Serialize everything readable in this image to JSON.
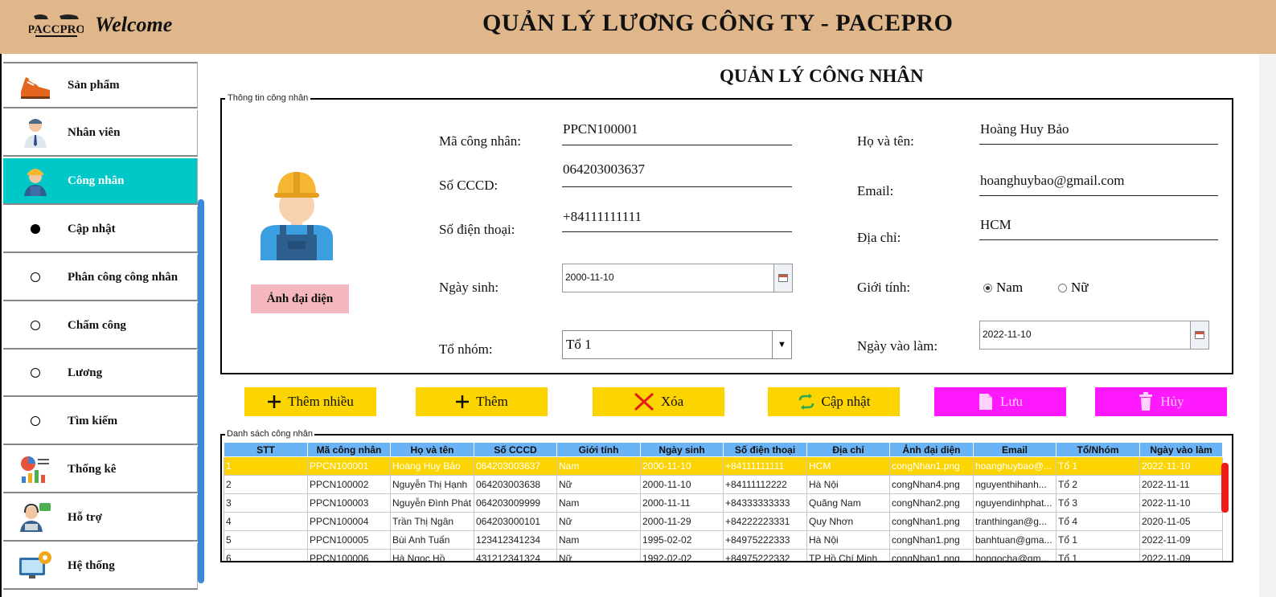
{
  "header": {
    "logo_text": "PACCPRO",
    "welcome": "Welcome",
    "title": "QUẢN LÝ LƯƠNG CÔNG TY - PACEPRO"
  },
  "sidebar": {
    "items": [
      {
        "label": "Sản phẩm",
        "icon": "shoe-icon"
      },
      {
        "label": "Nhân viên",
        "icon": "employee-icon"
      },
      {
        "label": "Công nhân",
        "icon": "worker-icon",
        "active": true
      },
      {
        "label": "Cập nhật",
        "icon": "dot-filled"
      },
      {
        "label": "Phân công công nhân",
        "icon": "dot-empty"
      },
      {
        "label": "Chấm công",
        "icon": "dot-empty"
      },
      {
        "label": "Lương",
        "icon": "dot-empty"
      },
      {
        "label": "Tìm kiếm",
        "icon": "dot-empty"
      },
      {
        "label": "Thống kê",
        "icon": "statistics-icon"
      },
      {
        "label": "Hỗ trợ",
        "icon": "support-icon"
      },
      {
        "label": "Hệ thống",
        "icon": "system-icon"
      }
    ]
  },
  "page": {
    "title": "QUẢN LÝ CÔNG NHÂN",
    "info_legend": "Thông tin công nhân",
    "avatar_button": "Ảnh đại diện"
  },
  "form": {
    "ma_label": "Mã công nhân:",
    "ma_value": "PPCN100001",
    "cccd_label": "Số CCCD:",
    "cccd_value": "064203003637",
    "sdt_label": "Số điện thoại:",
    "sdt_value": "+84111111111",
    "ngaysinh_label": "Ngày sinh:",
    "ngaysinh_value": "2000-11-10",
    "tonhom_label": "Tổ nhóm:",
    "tonhom_value": "Tổ 1",
    "hoten_label": "Họ và tên:",
    "hoten_value": "Hoàng Huy Bảo",
    "email_label": "Email:",
    "email_value": "hoanghuybao@gmail.com",
    "diachi_label": "Địa chỉ:",
    "diachi_value": "HCM",
    "gioitinh_label": "Giới tính:",
    "gioitinh_options": [
      "Nam",
      "Nữ"
    ],
    "gioitinh_selected": "Nam",
    "ngayvaolam_label": "Ngày vào làm:",
    "ngayvaolam_value": "2022-11-10"
  },
  "actions": {
    "them_nhieu": "Thêm nhiều",
    "them": "Thêm",
    "xoa": "Xóa",
    "cap_nhat": "Cập nhật",
    "luu": "Lưu",
    "huy": "Hủy"
  },
  "table": {
    "legend": "Danh sách công nhân",
    "columns": [
      "STT",
      "Mã công nhân",
      "Họ và tên",
      "Số CCCD",
      "Giới tính",
      "Ngày sinh",
      "Số điện thoại",
      "Địa chỉ",
      "Ảnh đại diện",
      "Email",
      "Tổ/Nhóm",
      "Ngày vào làm"
    ],
    "rows": [
      [
        "1",
        "PPCN100001",
        "Hoàng Huy Bảo",
        "064203003637",
        "Nam",
        "2000-11-10",
        "+84111111111",
        "HCM",
        "congNhan1.png",
        "hoanghuybao@...",
        "Tổ 1",
        "2022-11-10"
      ],
      [
        "2",
        "PPCN100002",
        "Nguyễn Thị Hạnh",
        "064203003638",
        "Nữ",
        "2000-11-10",
        "+84111112222",
        "Hà Nội",
        "congNhan4.png",
        "nguyenthihanh...",
        "Tổ 2",
        "2022-11-11"
      ],
      [
        "3",
        "PPCN100003",
        "Nguyễn Đình Phát",
        "064203009999",
        "Nam",
        "2000-11-11",
        "+84333333333",
        "Quãng Nam",
        "congNhan2.png",
        "nguyendinhphat...",
        "Tổ 3",
        "2022-11-10"
      ],
      [
        "4",
        "PPCN100004",
        "Trần Thị Ngân",
        "064203000101",
        "Nữ",
        "2000-11-29",
        "+84222223331",
        "Quy Nhơn",
        "congNhan1.png",
        "tranthingan@g...",
        "Tổ 4",
        "2020-11-05"
      ],
      [
        "5",
        "PPCN100005",
        "Bùi Anh Tuấn",
        "123412341234",
        "Nam",
        "1995-02-02",
        "+84975222333",
        "Hà Nội",
        "congNhan1.png",
        "banhtuan@gma...",
        "Tổ 1",
        "2022-11-09"
      ],
      [
        "6",
        "PPCN100006",
        "Hà Ngọc Hồ",
        "431212341324",
        "Nữ",
        "1992-02-02",
        "+84975222332",
        "TP Hồ Chí Minh",
        "congNhan1.png",
        "hongocha@gm...",
        "Tổ 1",
        "2022-11-09"
      ]
    ],
    "selected_row": 0
  },
  "colors": {
    "header_bg": "#dfb78a",
    "active_sidebar": "#00c8c8",
    "button_yellow": "#fcd400",
    "button_magenta": "#ff19ff",
    "table_header": "#6ab3f7"
  }
}
